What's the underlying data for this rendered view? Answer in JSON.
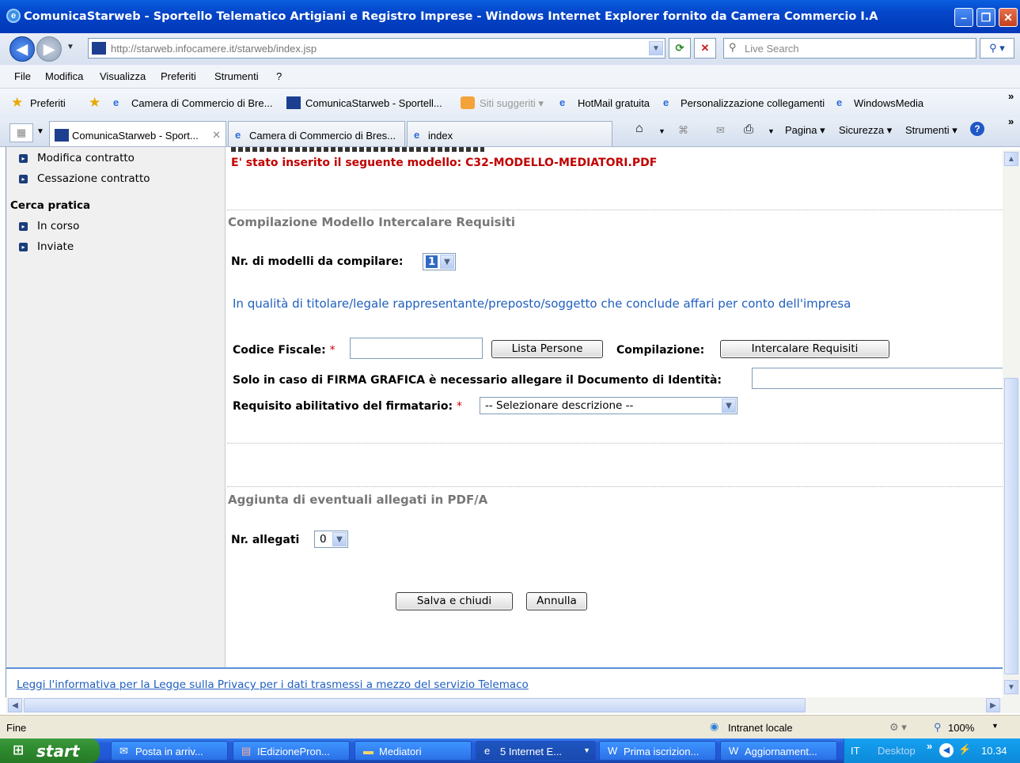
{
  "window": {
    "title": "ComunicaStarweb - Sportello Telematico Artigiani e Registro Imprese - Windows Internet Explorer fornito da Camera Commercio I.A",
    "url": "http://starweb.infocamere.it/starweb/index.jsp",
    "search_placeholder": "Live Search"
  },
  "menu": [
    "File",
    "Modifica",
    "Visualizza",
    "Preferiti",
    "Strumenti",
    "?"
  ],
  "favorites": {
    "label": "Preferiti",
    "links": [
      "Camera di Commercio di Bre...",
      "ComunicaStarweb - Sportell...",
      "Siti suggeriti ▾",
      "HotMail gratuita",
      "Personalizzazione collegamenti",
      "WindowsMedia"
    ]
  },
  "tabs": [
    "ComunicaStarweb - Sport...",
    "Camera di Commercio di Bres...",
    "index"
  ],
  "toolbar": {
    "pagina": "Pagina ▾",
    "sicurezza": "Sicurezza ▾",
    "strumenti": "Strumenti ▾"
  },
  "sidebar": {
    "items_top": [
      "Modifica contratto",
      "Cessazione contratto"
    ],
    "section": "Cerca pratica",
    "items_bottom": [
      "In corso",
      "Inviate"
    ]
  },
  "main": {
    "notice": "E' stato inserito il seguente modello: C32-MODELLO-MEDIATORI.PDF",
    "section1_title": "Compilazione Modello Intercalare Requisiti",
    "nr_modelli_label": "Nr. di modelli da compilare:",
    "nr_modelli_value": "1",
    "qualita_text": "In qualità di titolare/legale rappresentante/preposto/soggetto che conclude affari per conto dell'impresa",
    "codice_fiscale_label": "Codice Fiscale:",
    "required_mark": "*",
    "lista_persone_button": "Lista Persone",
    "compilazione_label": "Compilazione:",
    "intercalare_button": "Intercalare Requisiti",
    "firma_grafica_label": "Solo in caso di FIRMA GRAFICA è necessario allegare il Documento di Identità:",
    "requisito_label": "Requisito abilitativo del firmatario:",
    "requisito_value": "-- Selezionare descrizione --",
    "section2_title": "Aggiunta di eventuali allegati in PDF/A",
    "nr_allegati_label": "Nr. allegati",
    "nr_allegati_value": "0",
    "salva_button": "Salva e chiudi",
    "annulla_button": "Annulla",
    "privacy_link": "Leggi l'informativa per la Legge sulla Privacy per i dati trasmessi a mezzo del servizio Telemaco"
  },
  "status": {
    "left": "Fine",
    "zone": "Intranet locale",
    "zoom": "100%"
  },
  "taskbar": {
    "start": "start",
    "items": [
      "Posta in arriv...",
      "IEdizionePron...",
      "Mediatori",
      "5 Internet E...",
      "Prima iscrizion...",
      "Aggiornament..."
    ],
    "lang": "IT",
    "desktop": "Desktop",
    "clock": "10.34"
  }
}
